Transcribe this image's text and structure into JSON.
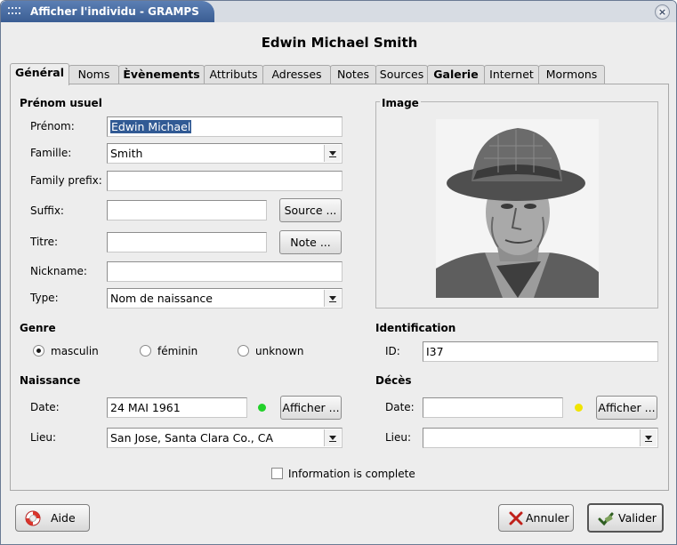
{
  "window": {
    "title": "Afficher l'individu - GRAMPS",
    "close_glyph": "×"
  },
  "person": {
    "name": "Edwin Michael Smith"
  },
  "tabs": [
    {
      "label": "Général",
      "active": true
    },
    {
      "label": "Noms"
    },
    {
      "label": "Èvènements",
      "bold": true
    },
    {
      "label": "Attributs"
    },
    {
      "label": "Adresses"
    },
    {
      "label": "Notes"
    },
    {
      "label": "Sources"
    },
    {
      "label": "Galerie",
      "bold": true
    },
    {
      "label": "Internet"
    },
    {
      "label": "Mormons"
    }
  ],
  "name_section": {
    "heading": "Prénom usuel",
    "given_label": "Prénom:",
    "given_value_selected": "Edwin Michael",
    "family_label": "Famille:",
    "family_value": "Smith",
    "prefix_label": "Family prefix:",
    "prefix_value": "",
    "suffix_label": "Suffix:",
    "suffix_value": "",
    "source_button": "Source ...",
    "title_label": "Titre:",
    "title_value": "",
    "note_button": "Note ...",
    "nickname_label": "Nickname:",
    "nickname_value": "",
    "type_label": "Type:",
    "type_value": "Nom de naissance"
  },
  "image_section": {
    "heading": "Image",
    "icon": "portrait-photo"
  },
  "gender": {
    "heading": "Genre",
    "options": [
      "masculin",
      "féminin",
      "unknown"
    ],
    "selected": "masculin"
  },
  "identification": {
    "heading": "Identification",
    "id_label": "ID:",
    "id_value": "I37"
  },
  "birth": {
    "heading": "Naissance",
    "date_label": "Date:",
    "date_value": "24 MAI 1961",
    "status_color": "#22d12a",
    "show_button": "Afficher ...",
    "place_label": "Lieu:",
    "place_value": "San Jose, Santa Clara Co., CA"
  },
  "death": {
    "heading": "Décès",
    "date_label": "Date:",
    "date_value": "",
    "status_color": "#f0e400",
    "show_button": "Afficher ...",
    "place_label": "Lieu:",
    "place_value": ""
  },
  "complete_checkbox": {
    "label": "Information is complete",
    "checked": false
  },
  "footer": {
    "help_button": "Aide",
    "help_icon": "lifebuoy-icon",
    "cancel_button": "Annuler",
    "cancel_icon": "red-x-icon",
    "ok_button": "Valider",
    "ok_icon": "check-hand-icon"
  }
}
